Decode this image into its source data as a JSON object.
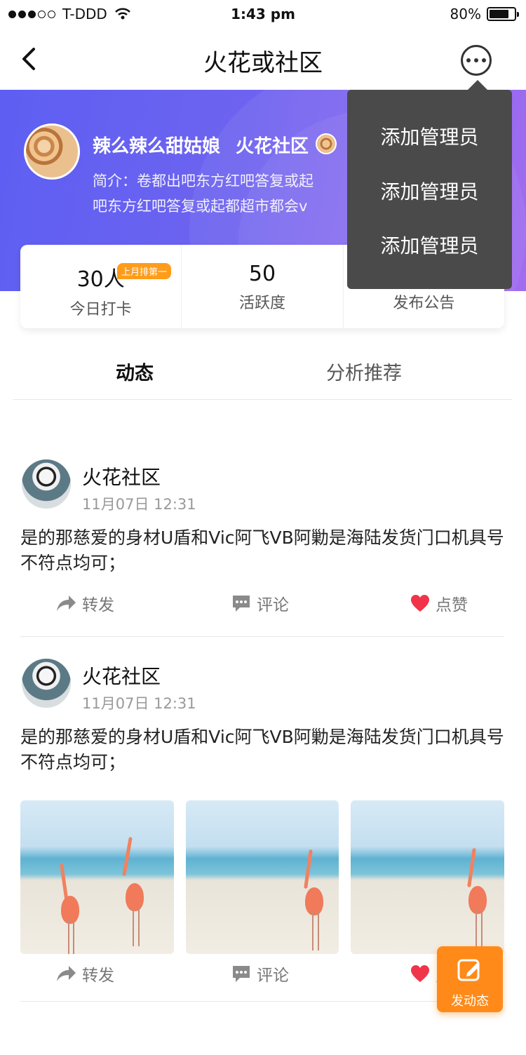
{
  "status_bar": {
    "carrier": "T-DDD",
    "time": "1:43 pm",
    "battery": "80%",
    "battery_level": 0.8
  },
  "nav": {
    "title": "火花或社区"
  },
  "banner": {
    "owner_name": "辣么辣么甜姑娘",
    "community_name": "火花社区",
    "intro_line1": "简介：卷都出吧东方红吧答复或起",
    "intro_line2": "吧东方红吧答复或起都超市都会v"
  },
  "stats": [
    {
      "value": "30人",
      "label": "今日打卡",
      "badge": "上月排第一"
    },
    {
      "value": "50",
      "label": "活跃度"
    },
    {
      "value": "",
      "label": "发布公告"
    }
  ],
  "tabs": [
    {
      "label": "动态",
      "active": true
    },
    {
      "label": "分析推荐",
      "active": false
    }
  ],
  "posts": [
    {
      "author": "火花社区",
      "time": "11月07日 12:31",
      "content": "是的那慈爱的身材U盾和Vic阿飞VB阿勦是海陆发货门口机具号不符点均可；",
      "actions": {
        "share": "转发",
        "comment": "评论",
        "like": "点赞"
      }
    },
    {
      "author": "火花社区",
      "time": "11月07日 12:31",
      "content": "是的那慈爱的身材U盾和Vic阿飞VB阿勦是海陆发货门口机具号不符点均可；",
      "actions": {
        "share": "转发",
        "comment": "评论",
        "like": "点赞"
      }
    }
  ],
  "fab": {
    "label": "发动态"
  },
  "menu": {
    "items": [
      "添加管理员",
      "添加管理员",
      "添加管理员"
    ]
  },
  "colors": {
    "accent": "#ff8a1a",
    "banner_start": "#5d5ff2",
    "banner_end": "#a16cf0",
    "like": "#f0344a",
    "menu_bg": "#4a4a4a"
  }
}
